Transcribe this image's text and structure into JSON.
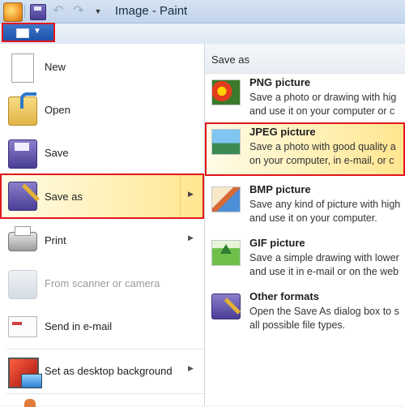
{
  "window": {
    "title": "Image - Paint"
  },
  "quick_access": {
    "undo_glyph": "↶",
    "redo_glyph": "↷",
    "dropdown_glyph": "▼"
  },
  "menu_button": {
    "caret": "▼"
  },
  "file_menu": {
    "items": [
      {
        "label": "New",
        "icon": "new-document-icon"
      },
      {
        "label": "Open",
        "icon": "open-folder-icon"
      },
      {
        "label": "Save",
        "icon": "floppy-disk-icon"
      },
      {
        "label": "Save as",
        "icon": "save-as-icon",
        "has_submenu": true,
        "highlighted": true
      },
      {
        "label": "Print",
        "icon": "printer-icon",
        "has_submenu": true
      },
      {
        "label": "From scanner or camera",
        "icon": "scanner-icon",
        "disabled": true
      },
      {
        "label": "Send in e-mail",
        "icon": "envelope-icon"
      },
      {
        "label": "Set as desktop background",
        "icon": "desktop-background-icon",
        "has_submenu": true
      }
    ],
    "submenu_arrow": "▶"
  },
  "save_as_panel": {
    "header": "Save as",
    "options": [
      {
        "title": "PNG picture",
        "line1": "Save a photo or drawing with hig",
        "line2": "and use it on your computer or c",
        "icon": "png-picture-icon"
      },
      {
        "title": "JPEG picture",
        "line1": "Save a photo with good quality a",
        "line2": "on your computer, in e-mail, or c",
        "icon": "jpeg-picture-icon",
        "highlighted": true
      },
      {
        "title": "BMP picture",
        "line1": "Save any kind of picture with high",
        "line2": "and use it on your computer.",
        "icon": "bmp-picture-icon"
      },
      {
        "title": "GIF picture",
        "line1": "Save a simple drawing with lower",
        "line2": "and use it in e-mail or on the web",
        "icon": "gif-picture-icon"
      },
      {
        "title": "Other formats",
        "line1": "Open the Save As dialog box to s",
        "line2": "all possible file types.",
        "icon": "other-formats-icon"
      }
    ]
  },
  "colors": {
    "highlight_border": "#e3161b",
    "menu_button": "#1d52a8",
    "highlight_fill": "#fff1b8"
  }
}
